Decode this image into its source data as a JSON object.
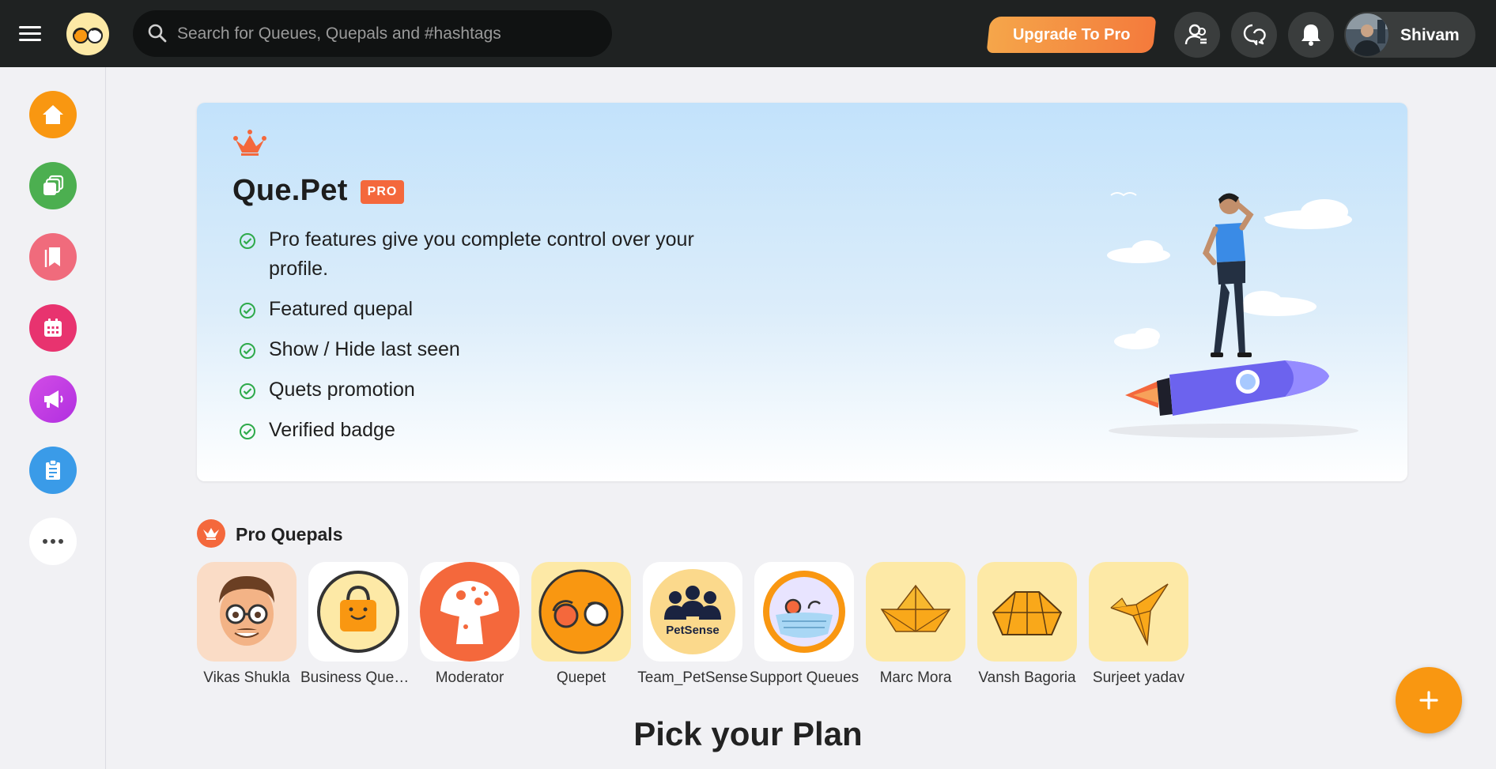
{
  "topbar": {
    "search_placeholder": "Search for Queues, Quepals and #hashtags",
    "upgrade_label": "Upgrade To Pro",
    "user_name": "Shivam"
  },
  "sidebar": {
    "items": [
      {
        "icon": "home-icon",
        "color": "#f99711"
      },
      {
        "icon": "layers-icon",
        "color": "#4caf50"
      },
      {
        "icon": "bookmark-icon",
        "color": "#f06b7c"
      },
      {
        "icon": "calendar-icon",
        "color": "#e8336f"
      },
      {
        "icon": "megaphone-icon",
        "color": "#c93ee6"
      },
      {
        "icon": "clipboard-icon",
        "color": "#3a9be8"
      },
      {
        "icon": "more-icon",
        "color": "#ffffff"
      }
    ]
  },
  "pro_card": {
    "brand": "Que.Pet",
    "badge": "PRO",
    "features": [
      "Pro features give you complete control over your profile.",
      "Featured quepal",
      "Show / Hide last seen",
      "Quets promotion",
      "Verified badge"
    ]
  },
  "pro_quepals": {
    "title": "Pro Quepals",
    "pals": [
      {
        "name": "Vikas Shukla"
      },
      {
        "name": "Business Queues"
      },
      {
        "name": "Moderator"
      },
      {
        "name": "Quepet"
      },
      {
        "name": "Team_PetSense"
      },
      {
        "name": "Support Queues"
      },
      {
        "name": "Marc Mora"
      },
      {
        "name": "Vansh Bagoria"
      },
      {
        "name": "Surjeet yadav"
      }
    ],
    "petsense_logo_text": "PetSense"
  },
  "plans": {
    "title": "Pick your Plan"
  },
  "colors": {
    "accent": "#f99711",
    "pro_orange": "#f4683c",
    "check_green": "#2eaa4a",
    "topbar": "#1f2222"
  }
}
